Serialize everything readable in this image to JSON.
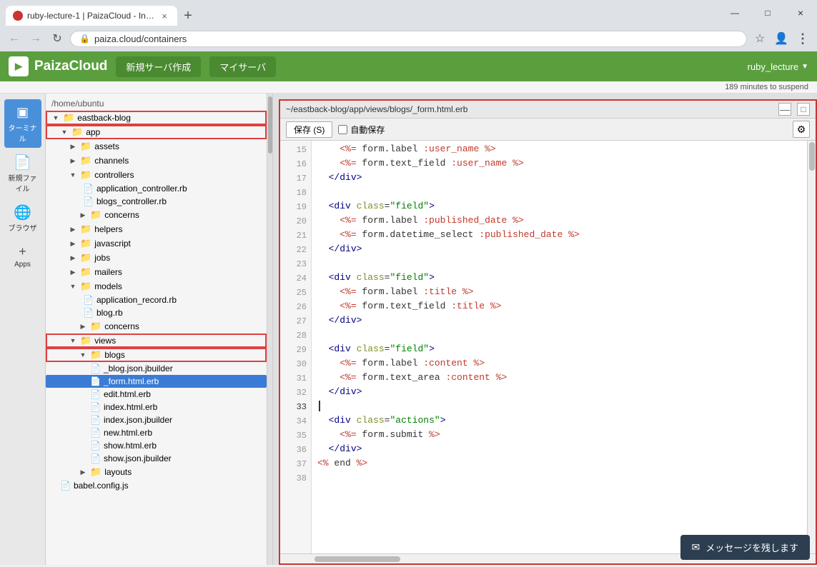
{
  "browser": {
    "tab_title": "ruby-lecture-1 | PaizaCloud - Ins...",
    "tab_close": "×",
    "tab_new": "+",
    "url": "paiza.cloud/containers",
    "url_protocol": "🔒",
    "nav_back": "←",
    "nav_forward": "→",
    "nav_refresh": "↻",
    "star": "☆",
    "profile": "👤",
    "menu": "⋮",
    "win_min": "—",
    "win_max": "□",
    "win_close": "×"
  },
  "paiza": {
    "logo": "PaizaCloud",
    "btn_new_server": "新規サーバ作成",
    "btn_my_server": "マイサーバ",
    "user": "ruby_lecture",
    "user_arrow": "▼",
    "suspend_info": "189 minutes to suspend"
  },
  "file_tree": {
    "root_path": "/home/ubuntu",
    "items": [
      {
        "id": "eastback-blog",
        "label": "eastback-blog",
        "type": "folder",
        "indent": 0,
        "open": true,
        "highlighted": true
      },
      {
        "id": "app",
        "label": "app",
        "type": "folder",
        "indent": 1,
        "open": true,
        "highlighted": true
      },
      {
        "id": "assets",
        "label": "assets",
        "type": "folder",
        "indent": 2,
        "open": false,
        "highlighted": false
      },
      {
        "id": "channels",
        "label": "channels",
        "type": "folder",
        "indent": 2,
        "open": false,
        "highlighted": false
      },
      {
        "id": "controllers",
        "label": "controllers",
        "type": "folder",
        "indent": 2,
        "open": true,
        "highlighted": false
      },
      {
        "id": "application_controller",
        "label": "application_controller.rb",
        "type": "file",
        "indent": 3,
        "highlighted": false
      },
      {
        "id": "blogs_controller",
        "label": "blogs_controller.rb",
        "type": "file",
        "indent": 3,
        "highlighted": false
      },
      {
        "id": "concerns1",
        "label": "concerns",
        "type": "folder",
        "indent": 3,
        "open": false,
        "highlighted": false
      },
      {
        "id": "helpers",
        "label": "helpers",
        "type": "folder",
        "indent": 2,
        "open": false,
        "highlighted": false
      },
      {
        "id": "javascript",
        "label": "javascript",
        "type": "folder",
        "indent": 2,
        "open": false,
        "highlighted": false
      },
      {
        "id": "jobs",
        "label": "jobs",
        "type": "folder",
        "indent": 2,
        "open": false,
        "highlighted": false
      },
      {
        "id": "mailers",
        "label": "mailers",
        "type": "folder",
        "indent": 2,
        "open": false,
        "highlighted": false
      },
      {
        "id": "models",
        "label": "models",
        "type": "folder",
        "indent": 2,
        "open": true,
        "highlighted": false
      },
      {
        "id": "application_record",
        "label": "application_record.rb",
        "type": "file",
        "indent": 3,
        "highlighted": false
      },
      {
        "id": "blog_rb",
        "label": "blog.rb",
        "type": "file",
        "indent": 3,
        "highlighted": false
      },
      {
        "id": "concerns2",
        "label": "concerns",
        "type": "folder",
        "indent": 3,
        "open": false,
        "highlighted": false
      },
      {
        "id": "views",
        "label": "views",
        "type": "folder",
        "indent": 2,
        "open": true,
        "highlighted": true
      },
      {
        "id": "blogs",
        "label": "blogs",
        "type": "folder",
        "indent": 3,
        "open": true,
        "highlighted": true
      },
      {
        "id": "_blog_json",
        "label": "_blog.json.jbuilder",
        "type": "file",
        "indent": 4,
        "highlighted": false
      },
      {
        "id": "_form_html",
        "label": "_form.html.erb",
        "type": "file",
        "indent": 4,
        "highlighted": false,
        "selected": true
      },
      {
        "id": "edit_html",
        "label": "edit.html.erb",
        "type": "file",
        "indent": 4,
        "highlighted": false
      },
      {
        "id": "index_html",
        "label": "index.html.erb",
        "type": "file",
        "indent": 4,
        "highlighted": false
      },
      {
        "id": "index_json",
        "label": "index.json.jbuilder",
        "type": "file",
        "indent": 4,
        "highlighted": false
      },
      {
        "id": "new_html",
        "label": "new.html.erb",
        "type": "file",
        "indent": 4,
        "highlighted": false
      },
      {
        "id": "show_html",
        "label": "show.html.erb",
        "type": "file",
        "indent": 4,
        "highlighted": false
      },
      {
        "id": "show_json",
        "label": "show.json.jbuilder",
        "type": "file",
        "indent": 4,
        "highlighted": false
      },
      {
        "id": "layouts",
        "label": "layouts",
        "type": "folder",
        "indent": 3,
        "open": false,
        "highlighted": false
      },
      {
        "id": "babel_config",
        "label": "babel.config.js",
        "type": "file",
        "indent": 1,
        "highlighted": false
      }
    ]
  },
  "editor": {
    "title": "~/eastback-blog/app/views/blogs/_form.html.erb",
    "save_btn": "保存 (S)",
    "autosave_label": "自動保存",
    "gear": "⚙",
    "lines": [
      {
        "num": 15,
        "content": "    <%= form.label :user_name %>"
      },
      {
        "num": 16,
        "content": "    <%= form.text_field :user_name %>"
      },
      {
        "num": 17,
        "content": "  </div>"
      },
      {
        "num": 18,
        "content": ""
      },
      {
        "num": 19,
        "content": "  <div class=\"field\">"
      },
      {
        "num": 20,
        "content": "    <%= form.label :published_date %>"
      },
      {
        "num": 21,
        "content": "    <%= form.datetime_select :published_date %>"
      },
      {
        "num": 22,
        "content": "  </div>"
      },
      {
        "num": 23,
        "content": ""
      },
      {
        "num": 24,
        "content": "  <div class=\"field\">"
      },
      {
        "num": 25,
        "content": "    <%= form.label :title %>"
      },
      {
        "num": 26,
        "content": "    <%= form.text_field :title %>"
      },
      {
        "num": 27,
        "content": "  </div>"
      },
      {
        "num": 28,
        "content": ""
      },
      {
        "num": 29,
        "content": "  <div class=\"field\">"
      },
      {
        "num": 30,
        "content": "    <%= form.label :content %>"
      },
      {
        "num": 31,
        "content": "    <%= form.text_area :content %>"
      },
      {
        "num": 32,
        "content": "  </div>"
      },
      {
        "num": 33,
        "content": ""
      },
      {
        "num": 34,
        "content": "  <div class=\"actions\">"
      },
      {
        "num": 35,
        "content": "    <%= form.submit %>"
      },
      {
        "num": 36,
        "content": "  </div>"
      },
      {
        "num": 37,
        "content": "<% end %>"
      },
      {
        "num": 38,
        "content": ""
      }
    ]
  },
  "tools": [
    {
      "id": "terminal",
      "label": "ターミナル",
      "icon": "▣"
    },
    {
      "id": "new-file",
      "label": "新規ファイル",
      "icon": "📄"
    },
    {
      "id": "browser",
      "label": "ブラウザ",
      "icon": "🌐"
    }
  ],
  "apps_label": "Apps",
  "message_btn": "メッセージを残します"
}
